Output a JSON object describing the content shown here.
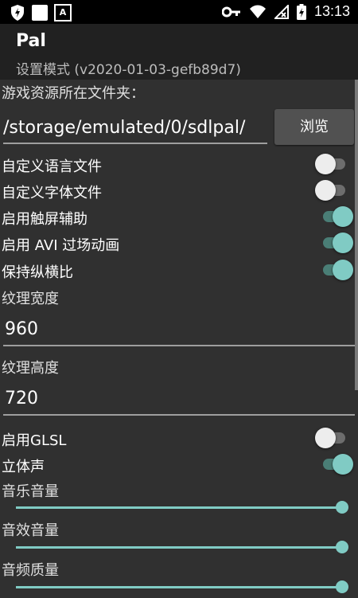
{
  "status": {
    "time": "13:13",
    "notif_a": "A"
  },
  "app": {
    "title": "Pal",
    "subtitle": "设置模式 (v2020-01-03-gefb89d7)"
  },
  "folder": {
    "label": "游戏资源所在文件夹：",
    "path": "/storage/emulated/0/sdlpal/",
    "browse": "浏览"
  },
  "toggles": [
    {
      "label": "自定义语言文件",
      "on": false
    },
    {
      "label": "自定义字体文件",
      "on": false
    },
    {
      "label": "启用触屏辅助",
      "on": true
    },
    {
      "label": "启用 AVI 过场动画",
      "on": true
    },
    {
      "label": "保持纵横比",
      "on": true
    }
  ],
  "texture_width": {
    "label": "纹理宽度",
    "value": "960"
  },
  "texture_height": {
    "label": "纹理高度",
    "value": "720"
  },
  "toggles2": [
    {
      "label": "启用GLSL",
      "on": false
    },
    {
      "label": "立体声",
      "on": true
    }
  ],
  "sliders": [
    {
      "label": "音乐音量",
      "level": 1.0
    },
    {
      "label": "音效音量",
      "level": 1.0
    },
    {
      "label": "音频质量",
      "level": 1.0
    }
  ],
  "colors": {
    "accent": "#80cbc4",
    "background": "#303030",
    "appbar": "#212121"
  }
}
